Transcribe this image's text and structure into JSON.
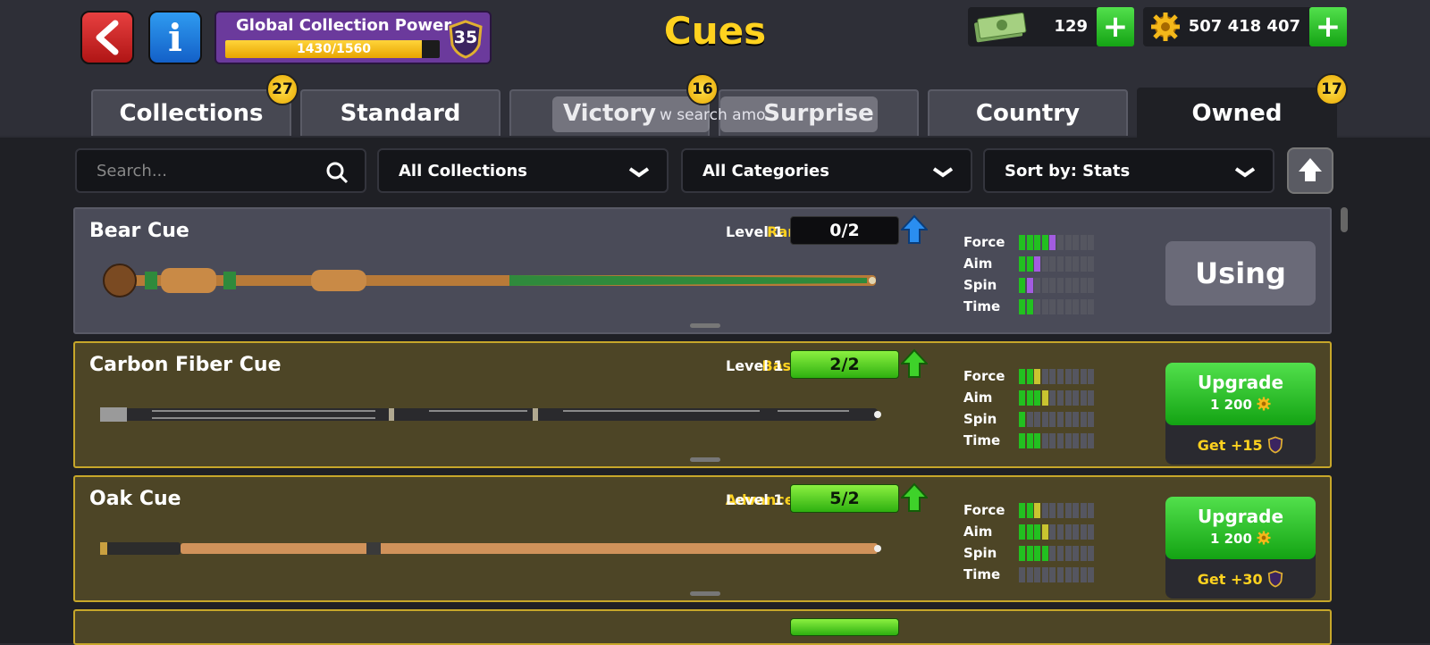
{
  "header": {
    "title": "Cues",
    "global_power": {
      "label": "Global Collection Power",
      "progress_text": "1430/1560",
      "progress": 0.917,
      "level": "35"
    },
    "cash": {
      "value": "129"
    },
    "coins": {
      "value": "507 418 407"
    }
  },
  "tabs": [
    {
      "label": "Collections",
      "badge": "27"
    },
    {
      "label": "Standard"
    },
    {
      "label": "Victory",
      "badge": "16"
    },
    {
      "label": "Surprise"
    },
    {
      "label": "Country"
    },
    {
      "label": "Owned",
      "badge": "17",
      "active": true
    }
  ],
  "overlay_text": "w search amo",
  "filters": {
    "search_placeholder": "Search...",
    "collections": "All Collections",
    "categories": "All Categories",
    "sort": "Sort by: Stats"
  },
  "cues": [
    {
      "name": "Bear Cue",
      "rarity": "Rare",
      "level": "Level 1",
      "progress": "0/2",
      "stats": {
        "Force": 5,
        "Aim": 3,
        "Spin": 2,
        "Time": 2
      },
      "stat_labels": [
        "Force",
        "Aim",
        "Spin",
        "Time"
      ],
      "action": "Using"
    },
    {
      "name": "Carbon Fiber Cue",
      "rarity": "Basic",
      "level": "Level 1",
      "progress": "2/2",
      "stats": {
        "Force": 3,
        "Aim": 4,
        "Spin": 1,
        "Time": 3
      },
      "stat_labels": [
        "Force",
        "Aim",
        "Spin",
        "Time"
      ],
      "action": "Upgrade",
      "cost": "1 200",
      "get": "Get +15"
    },
    {
      "name": "Oak Cue",
      "rarity": "Advanced",
      "level": "Level 1",
      "progress": "5/2",
      "stats": {
        "Force": 3,
        "Aim": 4,
        "Spin": 4,
        "Time": 0
      },
      "stat_labels": [
        "Force",
        "Aim",
        "Spin",
        "Time"
      ],
      "action": "Upgrade",
      "cost": "1 200",
      "get": "Get +30"
    }
  ],
  "colors": {
    "accent_gold": "#ffd21f",
    "green": "#22c020",
    "purple_stat": "#a35ce0",
    "rare_card": "#4a4b58",
    "upgrade_card": "#4d4526"
  }
}
